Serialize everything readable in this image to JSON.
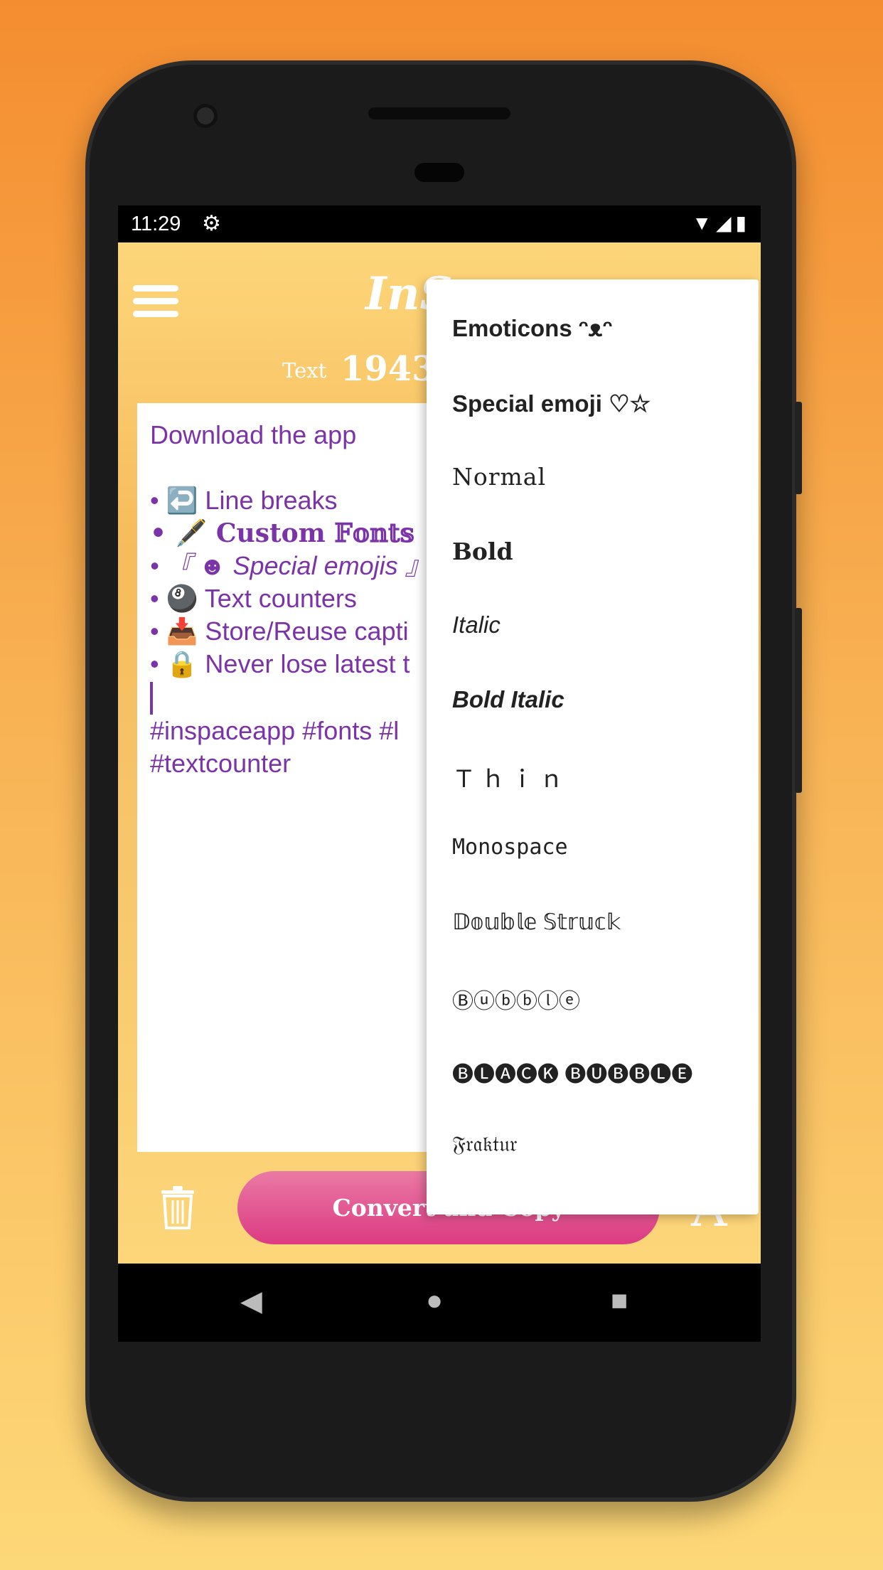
{
  "status": {
    "time": "11:29",
    "icons": [
      "gear-icon",
      "wifi-icon",
      "signal-icon",
      "battery-icon"
    ]
  },
  "header": {
    "title": "InS",
    "counter_label": "Text",
    "counter_value": "1943"
  },
  "editor": {
    "lines": [
      "Download the app",
      "",
      "• ↩️ Line breaks",
      "• 🖋️ 𝐂𝐮𝐬𝐭𝐨𝐦 𝔽𝕠𝕟𝕥𝕤",
      "• 『 ☻ Special emojis 』",
      "• 🎱 Text counters",
      "• 📥 Store/Reuse capti",
      "• 🔒 Never lose latest t",
      "#inspaceapp #fonts #l",
      "#textcounter"
    ]
  },
  "bottom": {
    "convert_label": "Convert and Copy",
    "font_button": "A"
  },
  "menu": {
    "items": [
      "Emoticons ᵔᴥᵔ",
      "Special emoji ♡☆",
      "Normal",
      "Bold",
      "Italic",
      "Bold Italic",
      "Ｔｈｉｎ",
      "Monospace",
      "𝔻𝕠𝕦𝕓𝕝𝕖 𝕊𝕥𝕣𝕦𝕔𝕜",
      "Ⓑⓤⓑⓑⓛⓔ",
      "🅑🅛🅐🅒🅚 🅑🅤🅑🅑🅛🅔",
      "𝔉𝔯𝔞𝔨𝔱𝔲𝔯"
    ]
  },
  "nav": {
    "back": "◀",
    "home": "●",
    "recents": "■"
  },
  "colors": {
    "text": "#7b33a8",
    "button": "#dc3a82",
    "background": "#f6bb5c"
  }
}
